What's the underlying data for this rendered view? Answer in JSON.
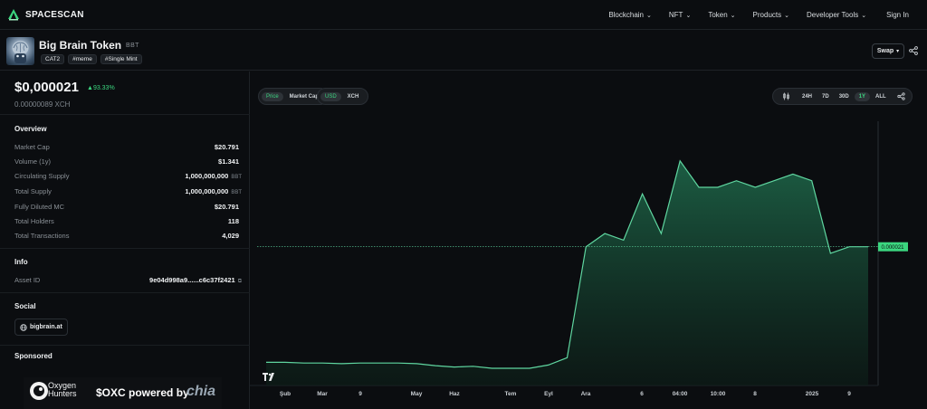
{
  "nav": {
    "brand": "SPACESCAN",
    "items": [
      "Blockchain",
      "NFT",
      "Token",
      "Products",
      "Developer Tools"
    ],
    "signin": "Sign In"
  },
  "token": {
    "name": "Big Brain Token",
    "symbol": "BBT",
    "tags": [
      "CAT2",
      "#meme",
      "#Single Mint"
    ],
    "swap_label": "Swap"
  },
  "price": {
    "usd": "$0,000021",
    "change": "93.33%",
    "xch": "0.00000089 XCH"
  },
  "overview": {
    "title": "Overview",
    "rows": [
      {
        "label": "Market Cap",
        "value": "$20.791",
        "unit": ""
      },
      {
        "label": "Volume (1y)",
        "value": "$1.341",
        "unit": ""
      },
      {
        "label": "Circulating Supply",
        "value": "1,000,000,000",
        "unit": "BBT"
      },
      {
        "label": "Total Supply",
        "value": "1,000,000,000",
        "unit": "BBT"
      },
      {
        "label": "Fully Diluted MC",
        "value": "$20.791",
        "unit": ""
      },
      {
        "label": "Total Holders",
        "value": "118",
        "unit": ""
      },
      {
        "label": "Total Transactions",
        "value": "4,029",
        "unit": ""
      }
    ]
  },
  "info": {
    "title": "Info",
    "asset_label": "Asset ID",
    "asset_value": "9e04d998a9......c6c37f2421"
  },
  "social": {
    "title": "Social",
    "site": "bigbrain.at"
  },
  "sponsored": {
    "title": "Sponsored",
    "brand_line1": "Oxygen",
    "brand_line2": "Hunters",
    "text": "$OXC powered by",
    "chia": "chia"
  },
  "chart_controls": {
    "type_pills": [
      "Price",
      "Market Cap"
    ],
    "currency_pills": [
      "USD",
      "XCH"
    ],
    "ranges": [
      "24H",
      "7D",
      "30D",
      "1Y",
      "ALL"
    ],
    "active_range": "1Y"
  },
  "chart_data": {
    "type": "area",
    "title": "",
    "xlabel": "",
    "ylabel": "",
    "current_price_label": "0.000021",
    "x_ticks": [
      "Şub",
      "Mar",
      "9",
      "May",
      "Haz",
      "Tem",
      "Eyl",
      "Ara",
      "6",
      "04:00",
      "10:00",
      "8",
      "2025",
      "9"
    ],
    "values": [
      3.5e-06,
      3.5e-06,
      3.4e-06,
      3.4e-06,
      3.3e-06,
      3.4e-06,
      3.4e-06,
      3.4e-06,
      3.3e-06,
      3e-06,
      2.8e-06,
      2.9e-06,
      2.6e-06,
      2.6e-06,
      2.6e-06,
      3.1e-06,
      4.2e-06,
      2.1e-05,
      2.3e-05,
      2.2e-05,
      2.9e-05,
      2.3e-05,
      3.4e-05,
      3e-05,
      3e-05,
      3.1e-05,
      3e-05,
      3.1e-05,
      3.2e-05,
      3.1e-05,
      2e-05,
      2.1e-05,
      2.1e-05
    ],
    "ylim": [
      0,
      4e-05
    ],
    "grid": false
  },
  "colors": {
    "accent": "#3bd67f",
    "line": "#5fd6a0",
    "fill_top": "#1f6b4c",
    "fill_bottom": "#0d1f18"
  }
}
